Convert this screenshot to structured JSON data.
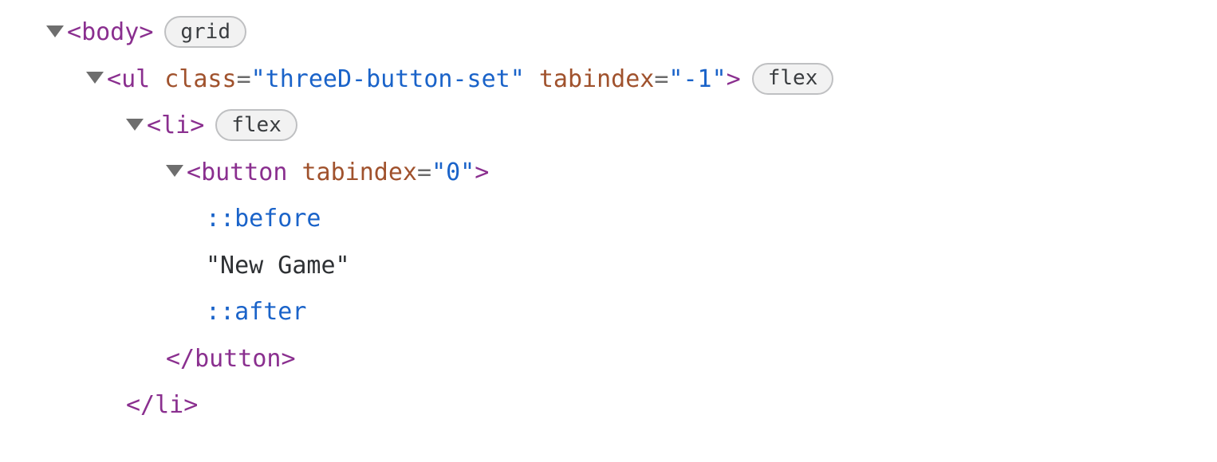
{
  "badges": {
    "grid": "grid",
    "flex": "flex"
  },
  "nodes": {
    "body": {
      "open_lt": "<",
      "tag": "body",
      "gt": ">"
    },
    "ul": {
      "open_lt": "<",
      "tag": "ul",
      "attr1_name": "class",
      "eq": "=",
      "attr1_val": "\"threeD-button-set\"",
      "attr2_name": "tabindex",
      "attr2_val": "\"-1\"",
      "gt": ">"
    },
    "li": {
      "open_lt": "<",
      "tag": "li",
      "gt": ">",
      "close_lt": "</",
      "close_gt": ">"
    },
    "button": {
      "open_lt": "<",
      "tag": "button",
      "attr1_name": "tabindex",
      "eq": "=",
      "attr1_val": "\"0\"",
      "gt": ">",
      "close_lt": "</",
      "close_gt": ">"
    },
    "pseudo_before": "::before",
    "pseudo_after": "::after",
    "text_node": "\"New Game\""
  }
}
